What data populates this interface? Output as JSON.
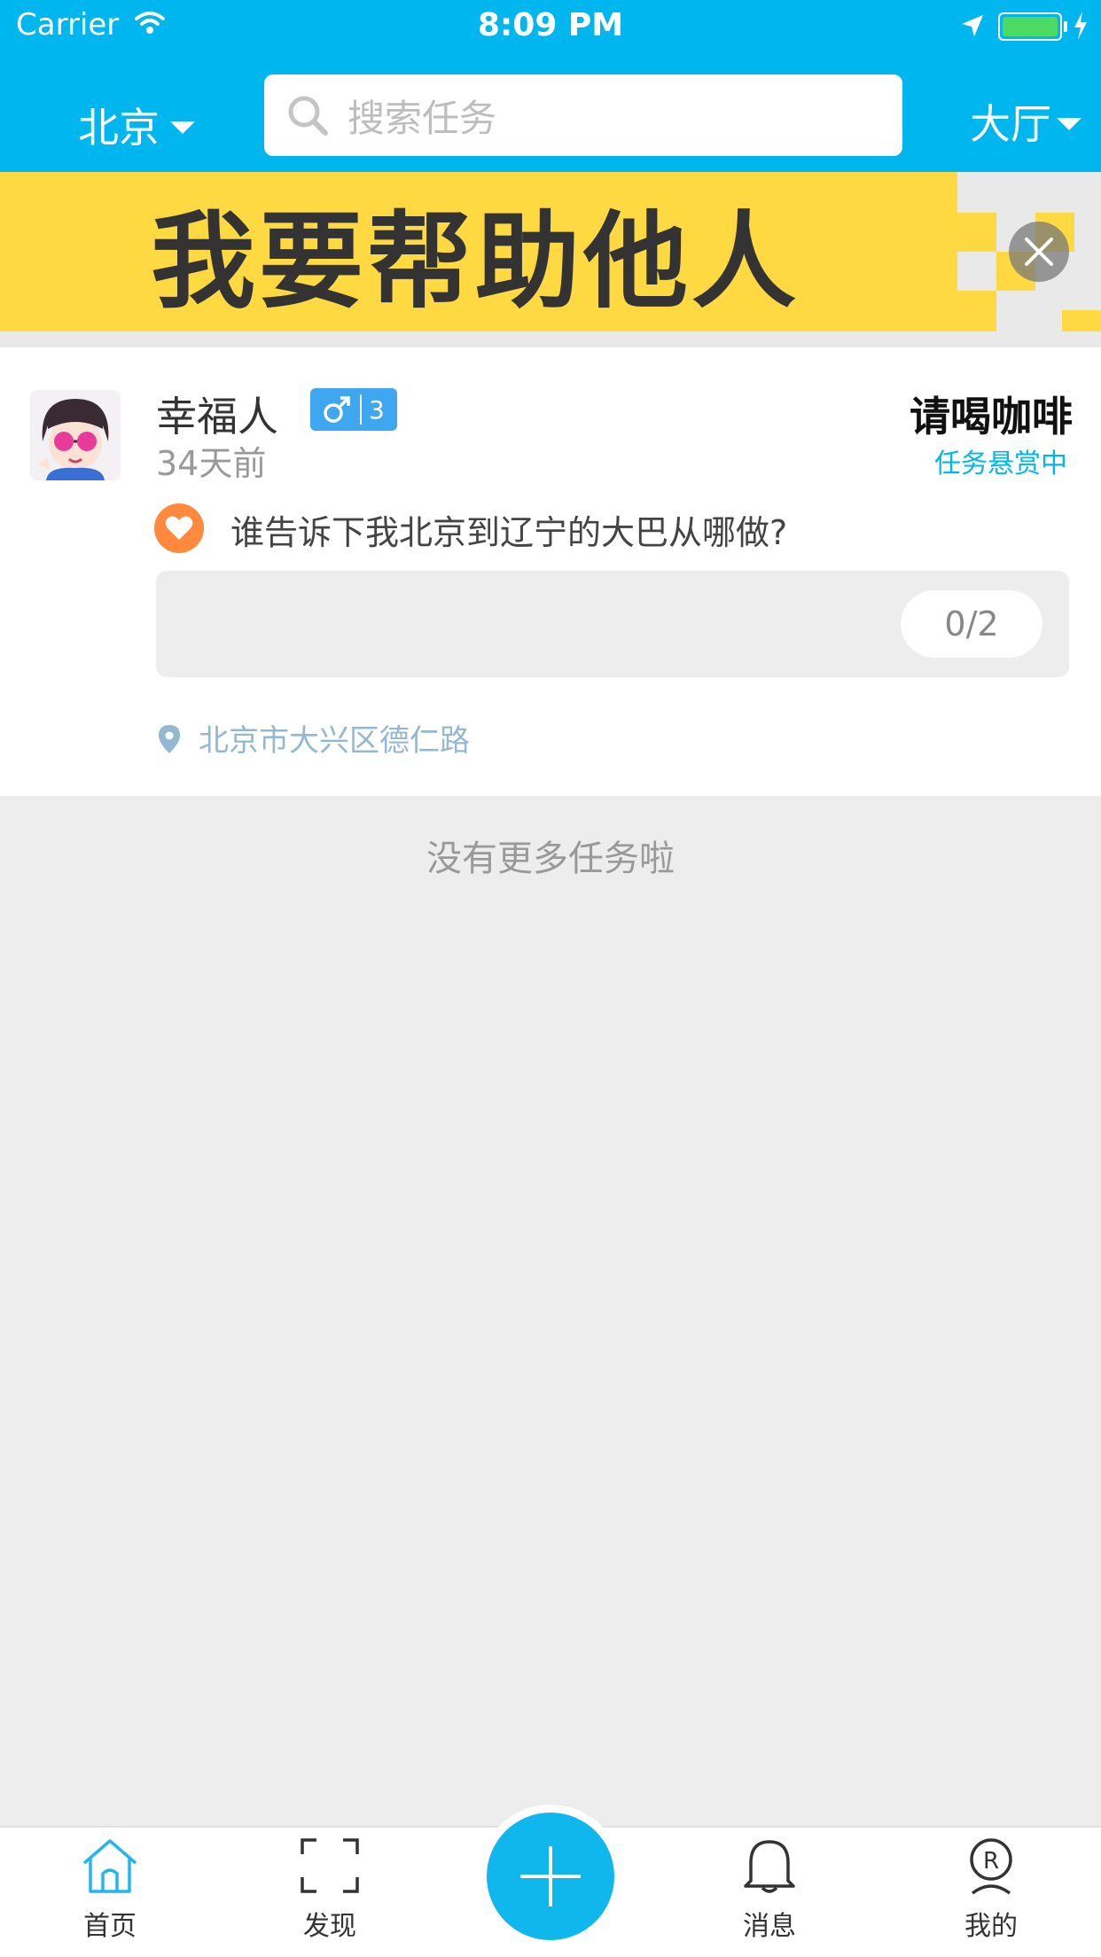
{
  "status_bar": {
    "carrier": "Carrier",
    "time": "8:09 PM"
  },
  "header": {
    "city": "北京",
    "search_placeholder": "搜索任务",
    "hall": "大厅"
  },
  "banner": {
    "text": "我要帮助他人"
  },
  "task": {
    "username": "幸福人",
    "gender_symbol": "♂",
    "level": "3",
    "time_ago": "34天前",
    "reward": "请喝咖啡",
    "reward_status": "任务悬赏中",
    "title": "谁告诉下我北京到辽宁的大巴从哪做?",
    "progress": "0/2",
    "address": "北京市大兴区德仁路"
  },
  "list_end": "没有更多任务啦",
  "tabs": [
    {
      "label": "首页",
      "icon": "home-icon"
    },
    {
      "label": "发现",
      "icon": "scan-icon"
    },
    {
      "label": "消息",
      "icon": "bell-icon"
    },
    {
      "label": "我的",
      "icon": "profile-icon"
    }
  ],
  "colors": {
    "brand": "#00b6ef",
    "banner": "#ffd941",
    "heart": "#ff8a3d",
    "badge": "#3fa6f0"
  }
}
